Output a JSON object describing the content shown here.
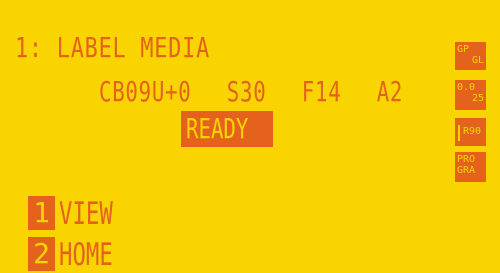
{
  "screen": {
    "title": "1: LABEL MEDIA",
    "params": "CB09U+0  S30  F14  A2",
    "status": "READY"
  },
  "menu": [
    {
      "number": "1",
      "label": "VIEW"
    },
    {
      "number": "2",
      "label": "HOME"
    }
  ],
  "side_buttons": {
    "gp_gl": {
      "line1": "GP",
      "line2": "GL"
    },
    "offset": {
      "line1": "0.0",
      "line2": "25"
    },
    "rotate": {
      "label": "R90"
    },
    "program": {
      "line1": "PRO",
      "line2": "GRA"
    }
  },
  "colors": {
    "background": "#f9d400",
    "foreground": "#e4621b"
  }
}
